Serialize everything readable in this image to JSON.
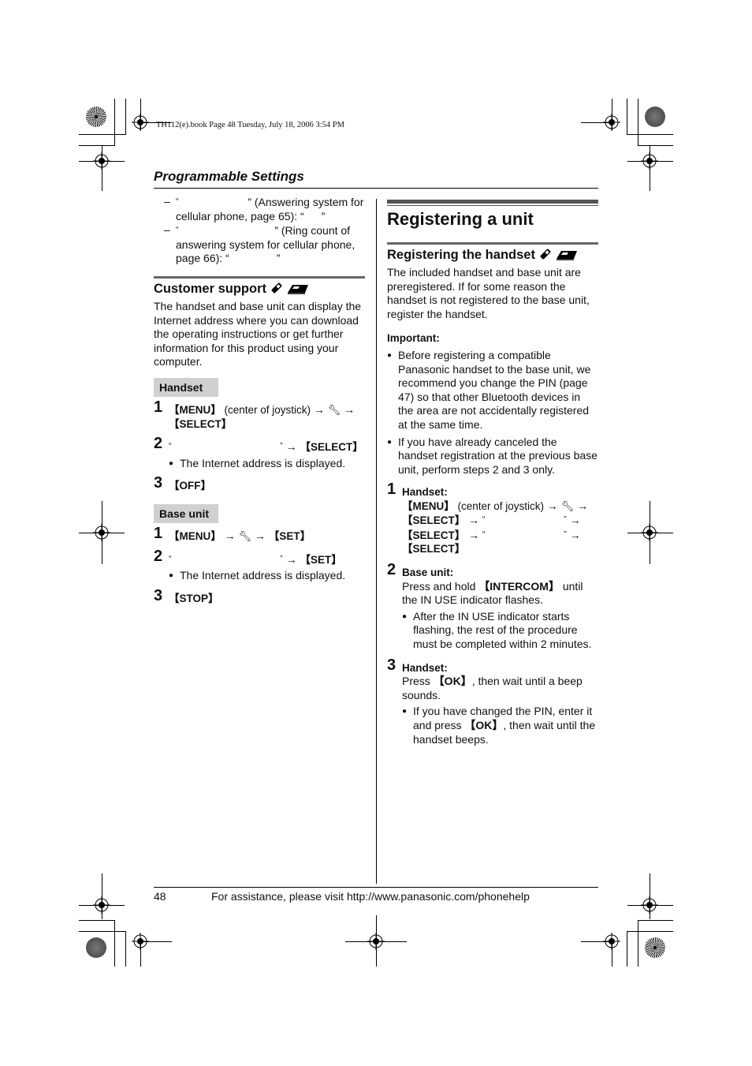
{
  "print_header": "TH112(e).book  Page 48  Tuesday, July 18, 2006  3:54 PM",
  "section_title": "Programmable Settings",
  "left": {
    "dash_items": [
      {
        "open": "“",
        "close": "” (Answering system for",
        "line2": "cellular phone, page 65): “",
        "line2_close": "”"
      },
      {
        "open": "“",
        "close": "” (Ring count of",
        "line2": "answering system for cellular phone,",
        "line3": "page 66): “",
        "line3_close": "”"
      }
    ],
    "customer_support": {
      "heading": "Customer support",
      "body": "The handset and base unit can display the Internet address where you can download the operating instructions or get further information for this product using your computer."
    },
    "handset": {
      "label": "Handset",
      "steps": [
        {
          "num": "1",
          "key1": "【MENU】",
          "text1": " (center of joystick) ",
          "arrow": "→",
          "key2": "【SELECT】"
        },
        {
          "num": "2",
          "open": "“",
          "close": "”",
          "arrow": "→",
          "key": "【SELECT】",
          "bullet": "The Internet address is displayed."
        },
        {
          "num": "3",
          "key": "【OFF】"
        }
      ]
    },
    "base_unit": {
      "label": "Base unit",
      "steps": [
        {
          "num": "1",
          "key1": "【MENU】",
          "arrow": "→",
          "key2": "【SET】"
        },
        {
          "num": "2",
          "open": "“",
          "close": "”",
          "arrow": "→",
          "key": "【SET】",
          "bullet": "The Internet address is displayed."
        },
        {
          "num": "3",
          "key": "【STOP】"
        }
      ]
    }
  },
  "right": {
    "title": "Registering a unit",
    "sub_heading": "Registering the handset",
    "intro": "The included handset and base unit are preregistered. If for some reason the handset is not registered to the base unit, register the handset.",
    "important_label": "Important:",
    "important_bullets": [
      "Before registering a compatible Panasonic handset to the base unit, we recommend you change the PIN (page 47) so that other Bluetooth devices in the area are not accidentally registered at the same time.",
      "If you have already canceled the handset registration at the previous base unit, perform steps 2 and 3 only."
    ],
    "steps": [
      {
        "num": "1",
        "label": "Handset:",
        "menu": "【MENU】",
        "menu_text": " (center of joystick) ",
        "arrow": "→",
        "select": "【SELECT】",
        "open": "“",
        "close": "”"
      },
      {
        "num": "2",
        "label": "Base unit:",
        "pre": "Press and hold ",
        "key": "【INTERCOM】",
        "post": " until the IN USE indicator flashes.",
        "bullet": "After the IN USE indicator starts flashing, the rest of the procedure must be completed within 2 minutes."
      },
      {
        "num": "3",
        "label": "Handset:",
        "pre": "Press ",
        "key": "【OK】",
        "post": ", then wait until a beep sounds.",
        "bullet_pre": "If you have changed the PIN, enter it and press ",
        "bullet_key": "【OK】",
        "bullet_post": ", then wait until the handset beeps."
      }
    ]
  },
  "footer": {
    "page_number": "48",
    "assistance": "For assistance, please visit http://www.panasonic.com/phonehelp"
  }
}
